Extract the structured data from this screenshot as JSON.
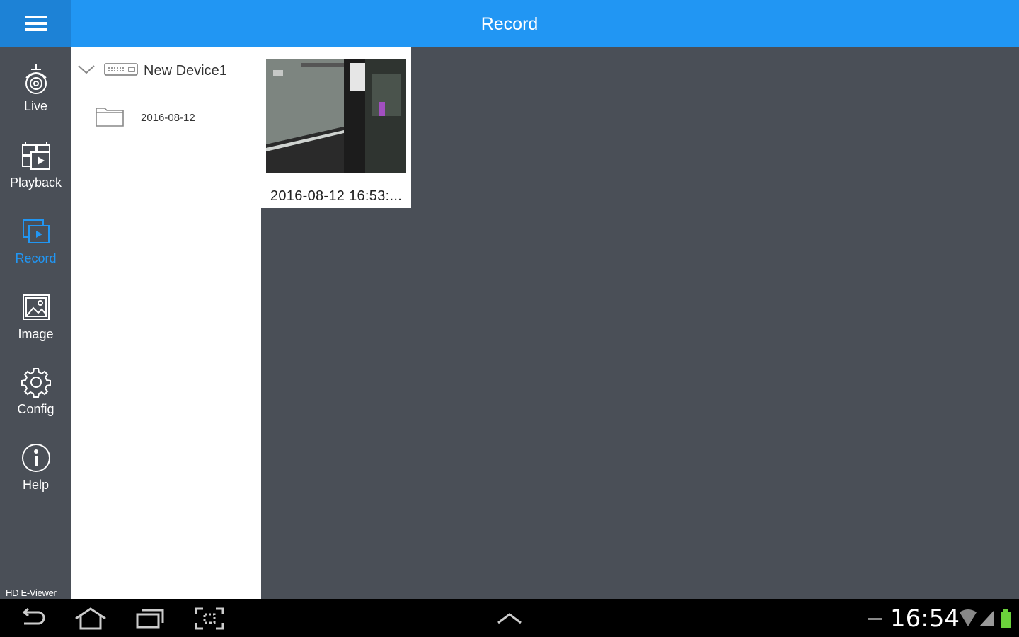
{
  "header": {
    "title": "Record",
    "accent": "#2196f3",
    "menu_icon": "hamburger-icon"
  },
  "sidebar": {
    "items": [
      {
        "label": "Live",
        "icon": "camera-icon",
        "active": false
      },
      {
        "label": "Playback",
        "icon": "playback-icon",
        "active": false
      },
      {
        "label": "Record",
        "icon": "record-icon",
        "active": true
      },
      {
        "label": "Image",
        "icon": "image-icon",
        "active": false
      },
      {
        "label": "Config",
        "icon": "gear-icon",
        "active": false
      },
      {
        "label": "Help",
        "icon": "info-icon",
        "active": false
      }
    ],
    "brand": "HD E-Viewer"
  },
  "tree": {
    "device": {
      "name": "New Device1",
      "icon": "dvr-icon",
      "expand_icon": "chevron-down-icon"
    },
    "folders": [
      {
        "name": "2016-08-12",
        "icon": "folder-icon"
      }
    ]
  },
  "recordings": [
    {
      "caption": "2016-08-12  16:53:..."
    }
  ],
  "system_bar": {
    "time": "16:54",
    "buttons": [
      "back-icon",
      "home-icon",
      "recent-apps-icon",
      "screenshot-icon",
      "chevron-up-icon"
    ],
    "indicators": [
      "wifi-icon",
      "signal-icon",
      "battery-icon"
    ]
  }
}
